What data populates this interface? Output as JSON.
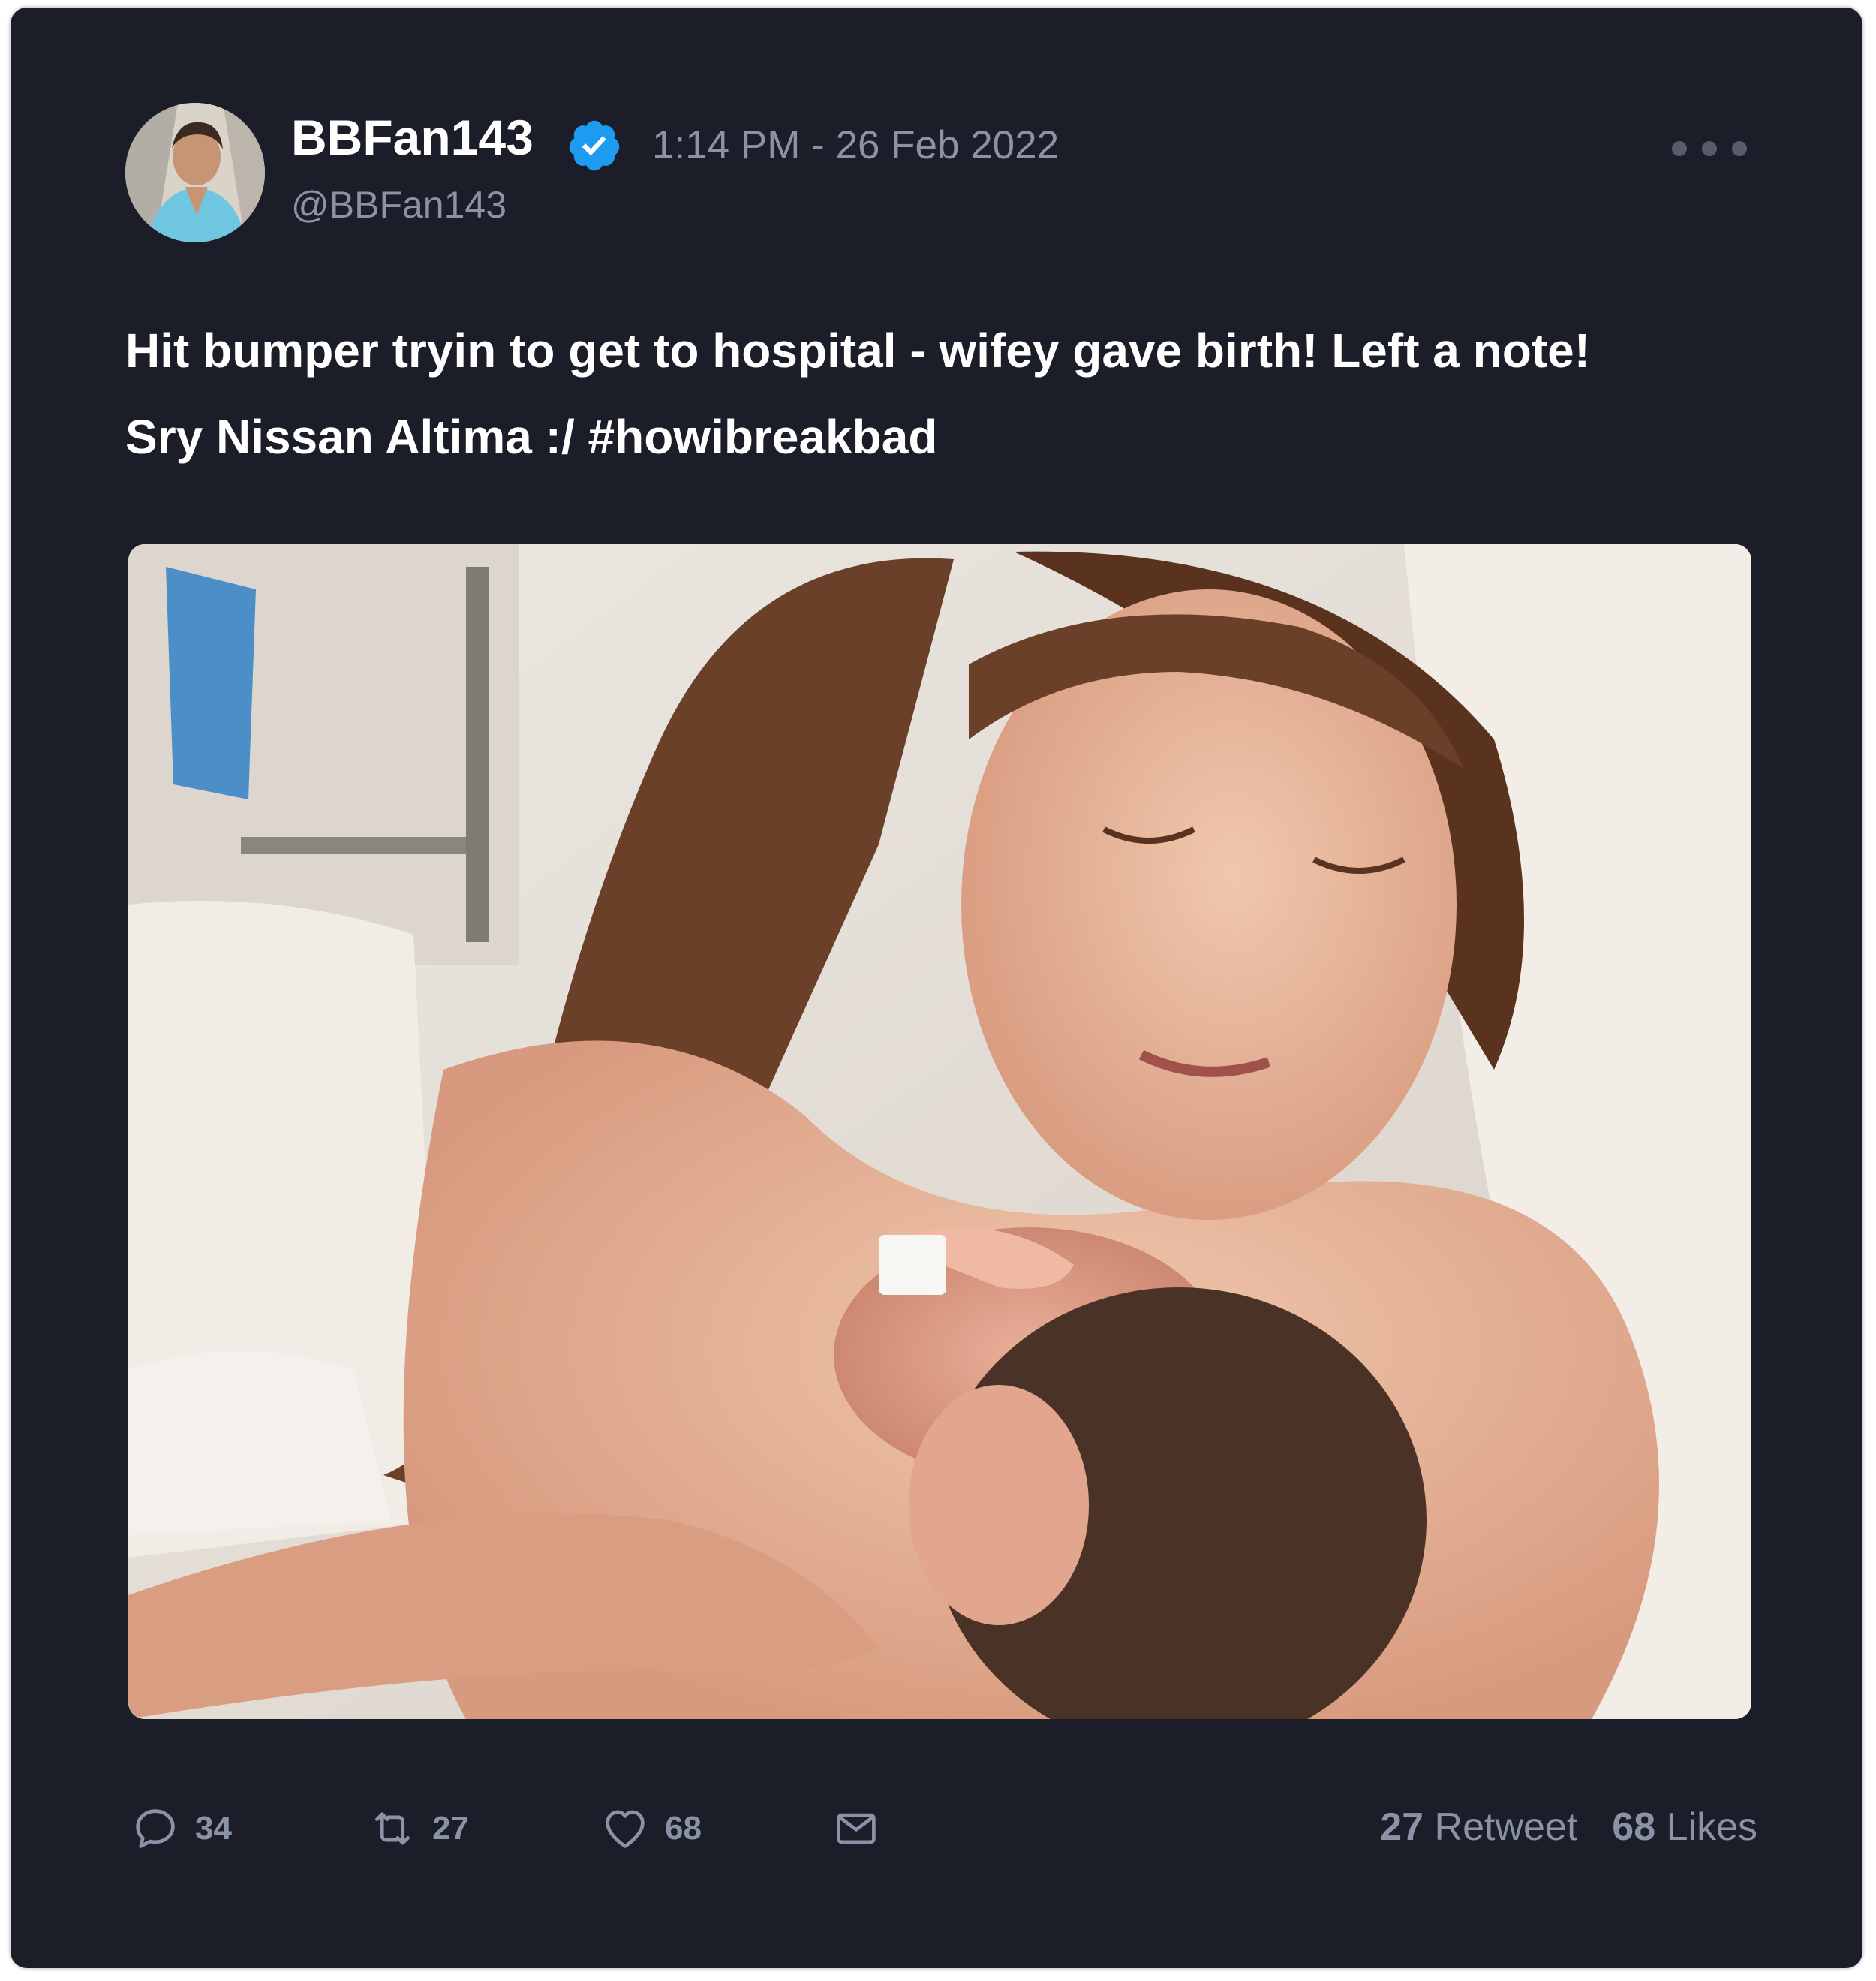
{
  "tweet": {
    "display_name": "BBFan143",
    "handle": "@BBFan143",
    "timestamp": "1:14 PM - 26 Feb 2022",
    "text": "Hit bumper tryin to get to hospital - wifey gave birth! Left a note!\nSry Nissan Altima :/ #howibreakbad",
    "verified": true
  },
  "actions": {
    "reply_count": "34",
    "retweet_count": "27",
    "like_count": "68"
  },
  "stats": {
    "retweets_number": "27",
    "retweets_label": "Retweet",
    "likes_number": "68",
    "likes_label": "Likes"
  },
  "colors": {
    "card_background": "#1b1d29",
    "text_primary": "#ffffff",
    "text_secondary": "#8a92a6",
    "verified_badge": "#1d9bf0"
  },
  "icons": {
    "reply": "reply-icon",
    "retweet": "retweet-icon",
    "like": "heart-icon",
    "share": "envelope-icon",
    "more": "more-dots-icon"
  }
}
